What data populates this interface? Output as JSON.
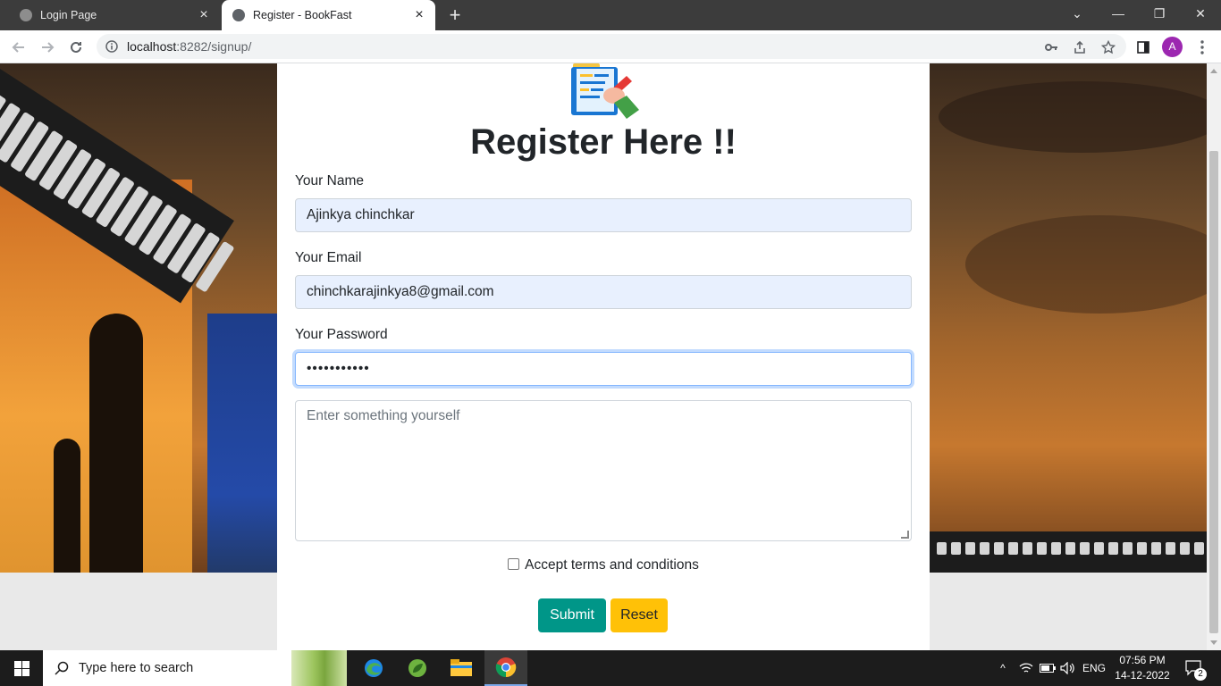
{
  "browser": {
    "tabs": [
      {
        "title": "Login Page"
      },
      {
        "title": "Register - BookFast"
      }
    ],
    "url_host": "localhost",
    "url_path": ":8282/signup/",
    "profile_initial": "A"
  },
  "form": {
    "heading": "Register Here !!",
    "name_label": "Your Name",
    "name_value": "Ajinkya chinchkar",
    "email_label": "Your Email",
    "email_value": "chinchkarajinkya8@gmail.com",
    "password_label": "Your Password",
    "password_masked": "•••••••••••",
    "about_placeholder": "Enter something yourself",
    "terms_label": "Accept terms and conditions",
    "terms_checked": false,
    "submit_label": "Submit",
    "reset_label": "Reset"
  },
  "taskbar": {
    "search_placeholder": "Type here to search",
    "language": "ENG",
    "time": "07:56 PM",
    "date": "14-12-2022",
    "notification_count": "2"
  },
  "colors": {
    "submit": "#009688",
    "reset": "#ffc107",
    "autofill": "#e8f0fe",
    "profile": "#9c27b0"
  }
}
